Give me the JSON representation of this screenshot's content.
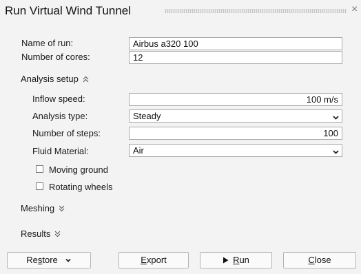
{
  "dialog": {
    "title": "Run Virtual Wind Tunnel",
    "close_symbol": "×"
  },
  "run": {
    "name_label": "Name of run:",
    "name_value": "Airbus a320 100",
    "cores_label": "Number of cores:",
    "cores_value": "12"
  },
  "analysis_setup": {
    "header": "Analysis setup",
    "expanded": true,
    "inflow_speed_label": "Inflow speed:",
    "inflow_speed_value": "100 m/s",
    "analysis_type_label": "Analysis type:",
    "analysis_type_value": "Steady",
    "steps_label": "Number of steps:",
    "steps_value": "100",
    "fluid_label": "Fluid Material:",
    "fluid_value": "Air",
    "moving_ground_label": "Moving ground",
    "moving_ground_checked": false,
    "rotating_wheels_label": "Rotating wheels",
    "rotating_wheels_checked": false
  },
  "meshing": {
    "header": "Meshing",
    "expanded": false
  },
  "results": {
    "header": "Results",
    "expanded": false
  },
  "buttons": {
    "restore_pre": "Re",
    "restore_ul": "s",
    "restore_post": "tore",
    "export_ul": "E",
    "export_post": "xport",
    "run_ul": "R",
    "run_post": "un",
    "close_ul": "C",
    "close_post": "lose"
  },
  "icons": {
    "expand": "chevron-double-up-icon",
    "collapse": "chevron-double-down-icon",
    "dropdown": "chevron-down-icon",
    "run": "play-icon",
    "close": "close-icon"
  }
}
